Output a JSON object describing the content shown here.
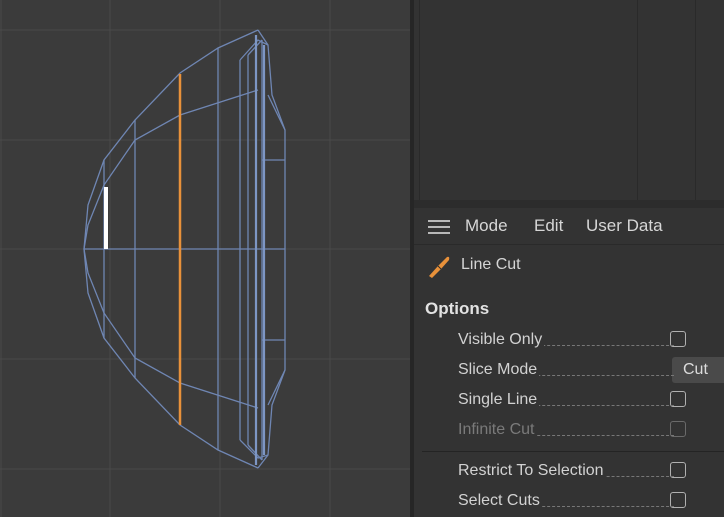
{
  "menu": {
    "items": [
      "Mode",
      "Edit",
      "User Data"
    ]
  },
  "tool": {
    "name": "Line Cut",
    "icon": "knife-icon"
  },
  "options": {
    "title": "Options",
    "visible_only": "Visible Only",
    "slice_mode": "Slice Mode",
    "slice_mode_value": "Cut",
    "single_line": "Single Line",
    "infinite_cut": "Infinite Cut",
    "restrict_to_selection": "Restrict To Selection",
    "select_cuts": "Select Cuts"
  },
  "colors": {
    "viewport_bg": "#3b3b3b",
    "wireframe": "#6f86b3",
    "cut_line": "#e8913a",
    "selected_edge": "#ffffff"
  }
}
